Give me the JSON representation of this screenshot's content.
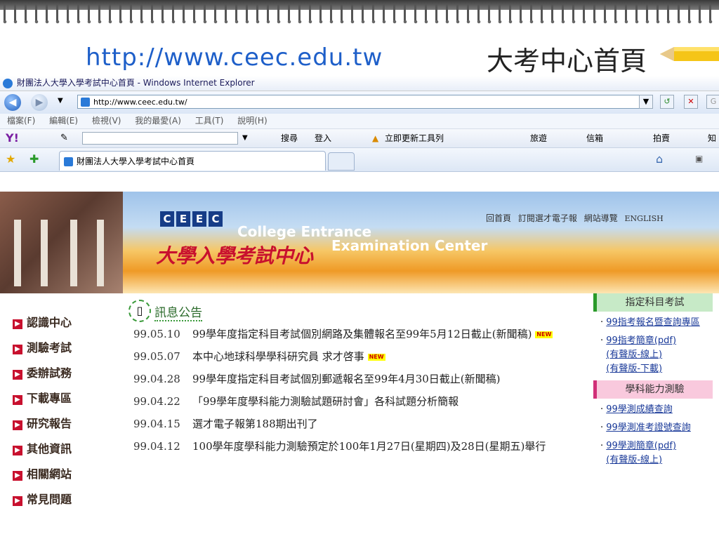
{
  "slide": {
    "url": "http://www.ceec.edu.tw",
    "title_zh": "大考中心首頁"
  },
  "browser": {
    "window_title": "財團法人大學入學考試中心首頁 - Windows Internet Explorer",
    "address": "http://www.ceec.edu.tw/",
    "go_button": "G",
    "menu": [
      "檔案(F)",
      "編輯(E)",
      "檢視(V)",
      "我的最愛(A)",
      "工具(T)",
      "說明(H)"
    ],
    "toolbar": {
      "search": "搜尋",
      "login": "登入",
      "update": "立即更新工具列",
      "travel": "旅遊",
      "mail": "信箱",
      "auction": "拍賣",
      "know": "知"
    },
    "tab_title": "財團法人大學入學考試中心首頁"
  },
  "site": {
    "logo_letters": [
      "C",
      "E",
      "E",
      "C"
    ],
    "logo_en_1": "College Entrance",
    "logo_en_2": "Examination Center",
    "logo_zh": "大學入學考試中心",
    "top_nav": [
      "回首頁",
      "訂閱選才電子報",
      "網站導覽",
      "ENGLISH"
    ],
    "left_nav": [
      "認識中心",
      "測驗考試",
      "委辦試務",
      "下載專區",
      "研究報告",
      "其他資訊",
      "相關網站",
      "常見問題"
    ],
    "news_header": "訊息公告",
    "new_badge": "NEW",
    "news": [
      {
        "date": "99.05.10",
        "text": "99學年度指定科目考試個別網路及集體報名至99年5月12日截止(新聞稿)",
        "new": true
      },
      {
        "date": "99.05.07",
        "text": "本中心地球科學學科研究員 求才啓事",
        "new": true
      },
      {
        "date": "99.04.28",
        "text": "99學年度指定科目考試個別郵遞報名至99年4月30日截止(新聞稿)",
        "new": false
      },
      {
        "date": "99.04.22",
        "text": "「99學年度學科能力測驗試題研討會」各科試題分析簡報",
        "new": false
      },
      {
        "date": "99.04.15",
        "text": "選才電子報第188期出刊了",
        "new": false
      },
      {
        "date": "99.04.12",
        "text": "100學年度學科能力測驗預定於100年1月27日(星期四)及28日(星期五)舉行",
        "new": false
      }
    ],
    "side_section1": "指定科目考試",
    "side_links1": [
      "99指考報名暨查詢專區",
      "99指考簡章(pdf)",
      "(有聲版-線上)",
      "(有聲版-下載)"
    ],
    "side_section2": "學科能力測驗",
    "side_links2": [
      "99學測成績查詢",
      "99學測准考證號查詢",
      "99學測簡章(pdf)",
      "(有聲版-線上)"
    ],
    "colors": {
      "red": "#c8102e",
      "green": "#2a9a2a",
      "pink": "#d12f78",
      "link": "#1a3a99"
    }
  }
}
